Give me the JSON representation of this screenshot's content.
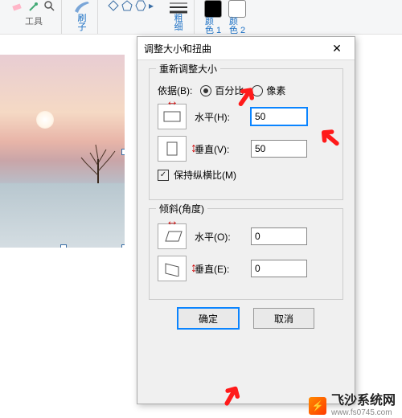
{
  "ribbon": {
    "tools_label": "工具",
    "brush_label": "刷\n子",
    "thickness_label": "粗\n细",
    "color1_label": "颜\n色 1",
    "color2_label": "颜\n色 2",
    "eraser_icon": "eraser",
    "picker_icon": "eyedropper",
    "zoom_icon": "magnifier"
  },
  "dialog": {
    "title": "调整大小和扭曲",
    "resize_legend": "重新调整大小",
    "by_label": "依据(B):",
    "opt_percent": "百分比",
    "opt_pixels": "像素",
    "horiz_label": "水平(H):",
    "vert_label": "垂直(V):",
    "horiz_val": "50",
    "vert_val": "50",
    "keep_ratio": "保持纵横比(M)",
    "skew_legend": "倾斜(角度)",
    "skew_h_label": "水平(O):",
    "skew_v_label": "垂直(E):",
    "skew_h_val": "0",
    "skew_v_val": "0",
    "ok": "确定",
    "cancel": "取消"
  },
  "watermark": {
    "title": "飞沙系统网",
    "url": "www.fs0745.com"
  }
}
